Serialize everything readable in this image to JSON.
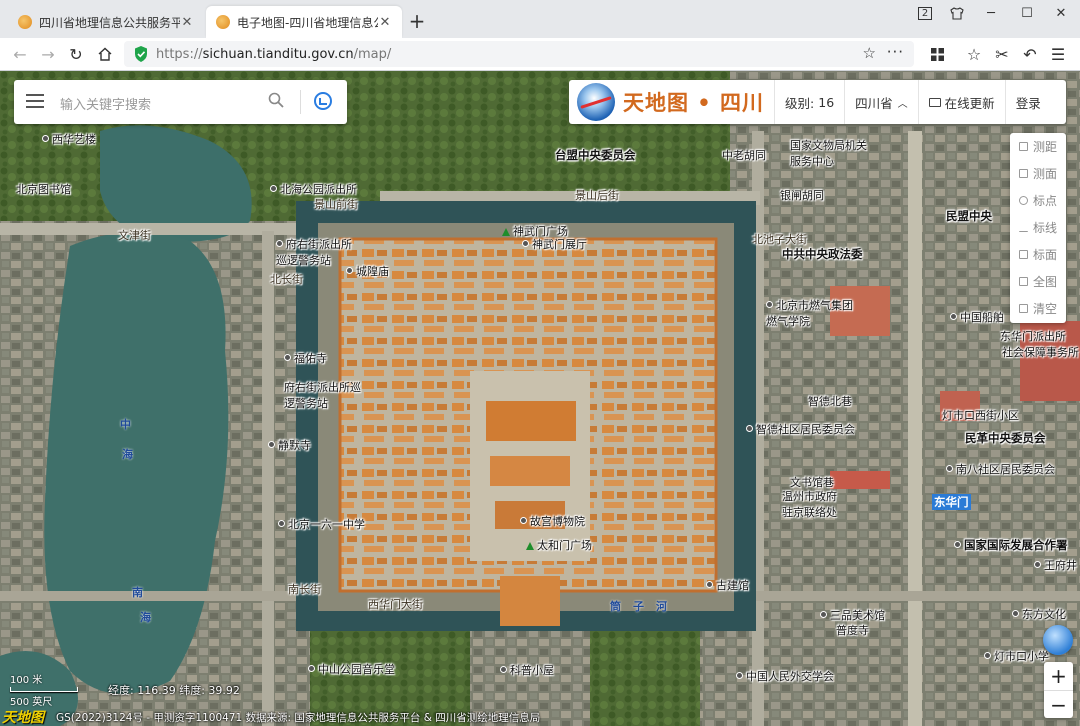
{
  "browser": {
    "tabs": [
      {
        "title": "四川省地理信息公共服务平台",
        "active": false
      },
      {
        "title": "电子地图-四川省地理信息公共",
        "active": true
      }
    ],
    "tab_count": "2",
    "url_prefix": "https://",
    "url_host": "sichuan.tianditu.gov.cn",
    "url_path": "/map/"
  },
  "search": {
    "placeholder": "输入关键字搜索"
  },
  "toolbar": {
    "brand": "天地图 • 四川",
    "level_label": "级别:",
    "level_value": "16",
    "region": "四川省",
    "update": "在线更新",
    "login": "登录"
  },
  "side_tools": [
    "测距",
    "测面",
    "标点",
    "标线",
    "标面",
    "全图",
    "清空"
  ],
  "zoom": {
    "in": "+",
    "out": "−"
  },
  "status": {
    "scale_m": "100 米",
    "scale_ft": "500 英尺",
    "coord_text": "经度: 116.39 纬度: 39.92",
    "brand_mark": "天地图",
    "copyright": "GS(2022)3124号 - 甲测资字1100471   数据来源: 国家地理信息公共服务平台 & 四川省测绘地理信息局"
  },
  "map_labels": [
    "西华艺楼",
    "北京图书馆",
    "文津街",
    "北海公园派出所",
    "景山前街",
    "景山后街",
    "台盟中央委员会",
    "中老胡同",
    "国家文物局机关服务中心",
    "府右街派出所巡逻警务站",
    "城隍庙",
    "北长街",
    "神武门广场",
    "神武门展厅",
    "北池子大街",
    "中共中央政法委",
    "北京市燃气集团燃气学院",
    "民盟中央",
    "中国船舶",
    "东华门派出所",
    "社会保障事务所",
    "福佑寺",
    "府右街派出所巡逻警务站",
    "静默寺",
    "智德北巷",
    "智德社区居民委员会",
    "灯市口西街小区",
    "民革中央委员会",
    "南八社区居民委员会",
    "文书馆巷",
    "温州市政府驻京联络处",
    "东华门",
    "北京一六一中学",
    "故宫博物院",
    "太和门广场",
    "国家国际发展合作署",
    "王府井",
    "古建馆",
    "南长街",
    "西华门大街",
    "筒子河",
    "三品美术馆",
    "普度寺",
    "东方文化",
    "中山公园音乐堂",
    "科普小屋",
    "中国人民外交学会",
    "灯市口小学",
    "银闸胡同",
    "中",
    "海",
    "南",
    "海"
  ]
}
